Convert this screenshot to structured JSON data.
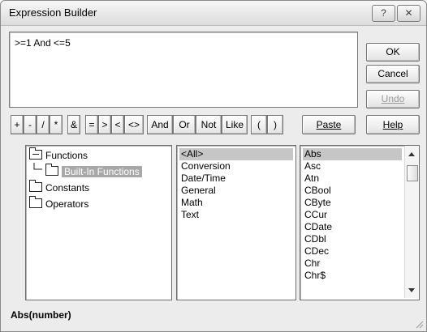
{
  "window": {
    "title": "Expression Builder",
    "help_btn": "?",
    "close_btn": "✕"
  },
  "expression": {
    "value": ">=1 And <=5"
  },
  "buttons": {
    "ok": "OK",
    "cancel": "Cancel",
    "undo": "Undo",
    "paste": "Paste",
    "help": "Help"
  },
  "operators": [
    "+",
    "-",
    "/",
    "*",
    "&",
    "=",
    ">",
    "<",
    "<>",
    "And",
    "Or",
    "Not",
    "Like",
    "(",
    ")"
  ],
  "tree": {
    "functions": "Functions",
    "builtin": "Built-In Functions",
    "constants": "Constants",
    "operators": "Operators"
  },
  "categories": [
    "<All>",
    "Conversion",
    "Date/Time",
    "General",
    "Math",
    "Text"
  ],
  "functions": [
    "Abs",
    "Asc",
    "Atn",
    "CBool",
    "CByte",
    "CCur",
    "CDate",
    "CDbl",
    "CDec",
    "Chr",
    "Chr$"
  ],
  "status": "Abs(number)"
}
